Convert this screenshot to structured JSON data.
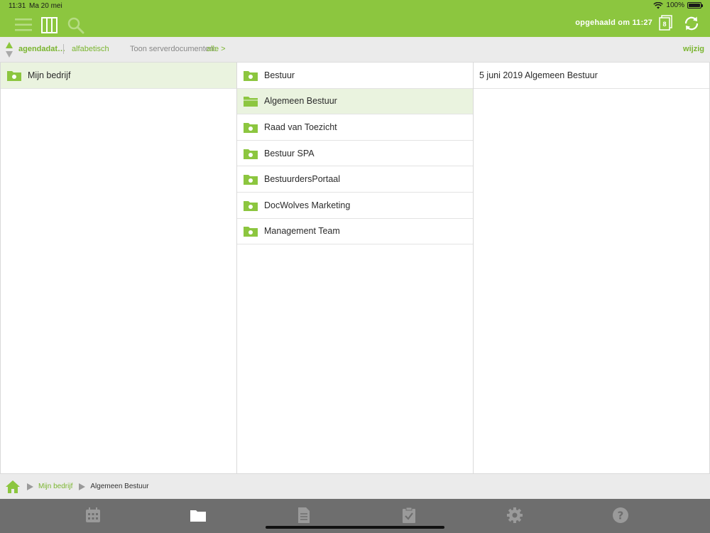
{
  "status_bar": {
    "time": "11:31",
    "date": "Ma 20 mei",
    "battery": "100%"
  },
  "toolbar": {
    "fetched_label": "opgehaald om 11:27",
    "badge_count": "8",
    "icons": [
      "menu-icon",
      "columns-icon",
      "search-icon",
      "download-queue-icon",
      "refresh-icon"
    ]
  },
  "sortbar": {
    "active_sort": "agendadat…",
    "alt_sort": "alfabetisch",
    "server_docs_label": "Toon serverdocumenten:",
    "server_docs_value": "alle >",
    "edit_label": "wijzig"
  },
  "columns": {
    "col1": [
      {
        "label": "Mijn bedrijf",
        "selected": true
      }
    ],
    "col2": [
      {
        "label": "Bestuur",
        "selected": false
      },
      {
        "label": "Algemeen Bestuur",
        "selected": true
      },
      {
        "label": "Raad van Toezicht",
        "selected": false
      },
      {
        "label": "Bestuur SPA",
        "selected": false
      },
      {
        "label": "BestuurdersPortaal",
        "selected": false
      },
      {
        "label": "DocWolves Marketing",
        "selected": false
      },
      {
        "label": "Management Team",
        "selected": false
      }
    ],
    "col3": [
      {
        "label": "5 juni 2019 Algemeen Bestuur"
      }
    ]
  },
  "breadcrumb": {
    "root": "Mijn bedrijf",
    "current": "Algemeen Bestuur"
  },
  "tabbar": {
    "tabs": [
      "calendar-icon",
      "folder-icon",
      "document-icon",
      "clipboard-check-icon",
      "gear-icon",
      "help-icon"
    ],
    "active": "folder-icon"
  },
  "colors": {
    "accent": "#8cc63f",
    "link": "#7ab52f",
    "tabbar": "#6e6e6e",
    "selected_row": "#eaf3df"
  }
}
